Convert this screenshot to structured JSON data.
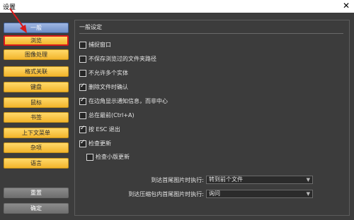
{
  "window": {
    "title": "设置",
    "close_glyph": "✕"
  },
  "sidebar": {
    "items": [
      {
        "label": "一般"
      },
      {
        "label": "浏览"
      },
      {
        "label": "图像处理"
      },
      {
        "label": "格式关联"
      },
      {
        "label": "键盘"
      },
      {
        "label": "鼠标"
      },
      {
        "label": "书签"
      },
      {
        "label": "上下文菜单"
      },
      {
        "label": "杂项"
      },
      {
        "label": "语言"
      }
    ],
    "reset_label": "重置",
    "ok_label": "确定"
  },
  "content": {
    "title": "一般设定",
    "options": [
      {
        "label": "捕捉窗口",
        "checked": false
      },
      {
        "label": "不保存浏览过的文件夹路径",
        "checked": false
      },
      {
        "label": "不允许多个实体",
        "checked": false
      },
      {
        "label": "删除文件时确认",
        "checked": true
      },
      {
        "label": "在边角显示通知信息，而非中心",
        "checked": true
      },
      {
        "label": "总在最前(Ctrl+A)",
        "checked": false
      },
      {
        "label": "按 ESC 退出",
        "checked": true
      },
      {
        "label": "检查更新",
        "checked": true
      },
      {
        "label": "检查小版更新",
        "checked": false
      }
    ],
    "first_image_label": "到达首尾图片时执行:",
    "first_image_value": "转到前个文件",
    "archive_label": "到达压缩包内首尾图片时执行:",
    "archive_value": "询问"
  },
  "colors": {
    "annotation_arrow": "#d91a1a"
  }
}
